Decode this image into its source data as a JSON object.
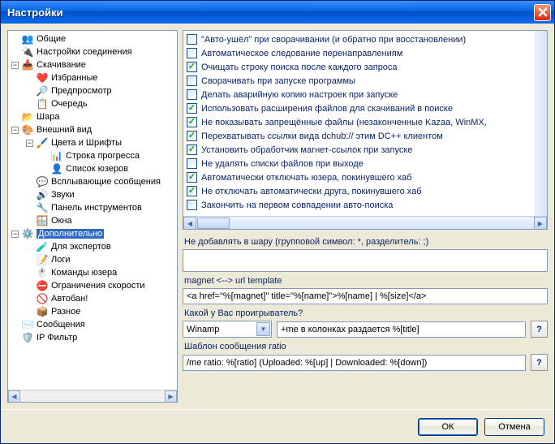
{
  "window": {
    "title": "Настройки"
  },
  "tree": [
    {
      "depth": 0,
      "expander": "none",
      "icon": "👥",
      "label": "Общие",
      "selected": false
    },
    {
      "depth": 0,
      "expander": "none",
      "icon": "🔌",
      "label": "Настройки соединения",
      "selected": false
    },
    {
      "depth": 0,
      "expander": "minus",
      "icon": "📥",
      "label": "Скачивание",
      "selected": false
    },
    {
      "depth": 1,
      "expander": "none",
      "icon": "❤️",
      "label": "Избранные",
      "selected": false
    },
    {
      "depth": 1,
      "expander": "none",
      "icon": "🔎",
      "label": "Предпросмотр",
      "selected": false
    },
    {
      "depth": 1,
      "expander": "none",
      "icon": "📋",
      "label": "Очередь",
      "selected": false
    },
    {
      "depth": 0,
      "expander": "none",
      "icon": "📂",
      "label": "Шара",
      "selected": false
    },
    {
      "depth": 0,
      "expander": "minus",
      "icon": "🎨",
      "label": "Внешний вид",
      "selected": false
    },
    {
      "depth": 1,
      "expander": "minus",
      "icon": "🖌️",
      "label": "Цвета и Шрифты",
      "selected": false
    },
    {
      "depth": 2,
      "expander": "none",
      "icon": "📊",
      "label": "Строка прогресса",
      "selected": false
    },
    {
      "depth": 2,
      "expander": "none",
      "icon": "👤",
      "label": "Список юзеров",
      "selected": false
    },
    {
      "depth": 1,
      "expander": "none",
      "icon": "💬",
      "label": "Всплывающие сообщения",
      "selected": false
    },
    {
      "depth": 1,
      "expander": "none",
      "icon": "🔊",
      "label": "Звуки",
      "selected": false
    },
    {
      "depth": 1,
      "expander": "none",
      "icon": "🔧",
      "label": "Панель инструментов",
      "selected": false
    },
    {
      "depth": 1,
      "expander": "none",
      "icon": "🪟",
      "label": "Окна",
      "selected": false
    },
    {
      "depth": 0,
      "expander": "minus",
      "icon": "⚙️",
      "label": "Дополнительно",
      "selected": true
    },
    {
      "depth": 1,
      "expander": "none",
      "icon": "🧪",
      "label": "Для экспертов",
      "selected": false
    },
    {
      "depth": 1,
      "expander": "none",
      "icon": "📝",
      "label": "Логи",
      "selected": false
    },
    {
      "depth": 1,
      "expander": "none",
      "icon": "🖱️",
      "label": "Команды юзера",
      "selected": false
    },
    {
      "depth": 1,
      "expander": "none",
      "icon": "⛔",
      "label": "Ограничения скорости",
      "selected": false
    },
    {
      "depth": 1,
      "expander": "none",
      "icon": "🚫",
      "label": "Автобан!",
      "selected": false
    },
    {
      "depth": 1,
      "expander": "none",
      "icon": "📦",
      "label": "Разное",
      "selected": false
    },
    {
      "depth": 0,
      "expander": "none",
      "icon": "✉️",
      "label": "Сообщения",
      "selected": false
    },
    {
      "depth": 0,
      "expander": "none",
      "icon": "🛡️",
      "label": "IP Фильтр",
      "selected": false
    }
  ],
  "options": [
    {
      "checked": false,
      "label": "\"Авто-ушёл\" при сворачивании (и обратно при восстановлении)"
    },
    {
      "checked": false,
      "label": "Автоматическое следование перенаправлениям"
    },
    {
      "checked": true,
      "label": "Очищать строку поиска после каждого запроса"
    },
    {
      "checked": false,
      "label": "Сворачивать при запуске программы"
    },
    {
      "checked": false,
      "label": "Делать аварийную копию настроек при запуске"
    },
    {
      "checked": true,
      "label": "Использовать расширения файлов для скачиваний в поиске"
    },
    {
      "checked": true,
      "label": "Не показывать запрещённые файлы (незаконченные Kazaa, WinMX,"
    },
    {
      "checked": true,
      "label": "Перехватывать ссылки вида dchub:// этим DC++ клиентом"
    },
    {
      "checked": true,
      "label": "Установить обработчик магнет-ссылок при запуске"
    },
    {
      "checked": false,
      "label": "Не удалять списки файлов при выходе"
    },
    {
      "checked": true,
      "label": "Автоматически отключать юзера, покинувшего хаб"
    },
    {
      "checked": true,
      "label": "Не отключать автоматически друга, покинувшего хаб"
    },
    {
      "checked": false,
      "label": "Закончить на первом совпадении авто-поиска"
    }
  ],
  "form": {
    "noshare_label": "Не добавлять в шару (групповой символ: *, разделитель: ;)",
    "noshare_value": "",
    "magnet_label": "magnet  <-->  url template",
    "magnet_value": "<a href=\"%[magnet]\" title=\"%[name]\">%[name] | %[size]</a>",
    "player_label": "Какой у Вас проигрыватель?",
    "player_selected": "Winamp",
    "player_cmd": "+me в колонках раздается %[title]",
    "ratio_label": "Шаблон сообщения ratio",
    "ratio_value": "/me ratio: %[ratio] (Uploaded: %[up] | Downloaded: %[down])",
    "help": "?"
  },
  "buttons": {
    "ok": "ОК",
    "cancel": "Отмена"
  }
}
